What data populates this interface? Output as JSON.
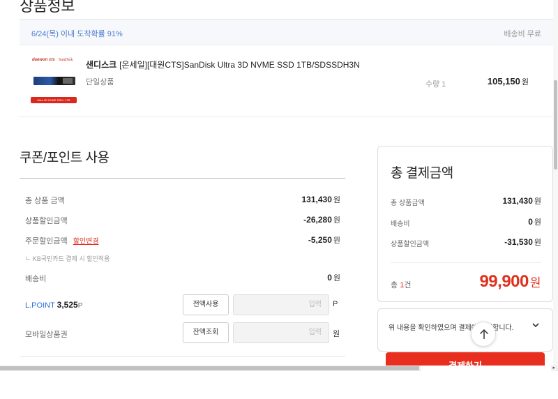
{
  "page": {
    "section_title": "상품정보"
  },
  "delivery": {
    "eta": "6/24(목) 이내 도착확률 91%",
    "shipping_fee": "배송비 무료"
  },
  "product": {
    "brand": "샌디스크",
    "name": "[온세일][대원CTS]SanDisk Ultra 3D NVME SSD 1TB/SDSSDH3N",
    "option": "단일상품",
    "quantity": "수량 1",
    "price": "105,150",
    "won": "원",
    "thumb_logo1": "daewon cts",
    "thumb_logo2": "SanDisk",
    "thumb_tag": "Ultra 3D NVME SSD / 1TB"
  },
  "coupon": {
    "title": "쿠폰/포인트 사용",
    "rows": [
      {
        "label": "총 상품 금액",
        "value": "131,430",
        "won": "원"
      },
      {
        "label": "상품할인금액",
        "value": "-26,280",
        "won": "원"
      },
      {
        "label": "주문할인금액",
        "link": "할인변경",
        "value": "-5,250",
        "won": "원"
      },
      {
        "label": "배송비",
        "value": "0",
        "won": "원"
      }
    ],
    "sub_note": "ㄴ KB국민카드 결제 시 할인적용",
    "lpoint_label": "L.POINT",
    "lpoint_value": "3,525",
    "lpoint_unit": "P",
    "lpoint_button": "전액사용",
    "lpoint_placeholder": "입력",
    "lpoint_input_unit": "P",
    "mobile_label": "모바일상품권",
    "mobile_button": "잔액조회",
    "mobile_placeholder": "입력",
    "mobile_input_unit": "원"
  },
  "total": {
    "title": "총 결제금액",
    "rows": [
      {
        "label": "총 상품금액",
        "value": "131,430",
        "won": "원"
      },
      {
        "label": "배송비",
        "value": "0",
        "won": "원"
      },
      {
        "label": "상품할인금액",
        "value": "-31,530",
        "won": "원"
      }
    ],
    "count_prefix": "총 ",
    "count_num": "1",
    "count_suffix": "건",
    "amount": "99,900",
    "won": "원"
  },
  "agree": {
    "text": "위 내용을 확인하였으며 결제에 동의합니다."
  },
  "pay_button": "결제하기",
  "colors": {
    "accent": "#e82e1f",
    "link_blue": "#4a7bd1"
  }
}
